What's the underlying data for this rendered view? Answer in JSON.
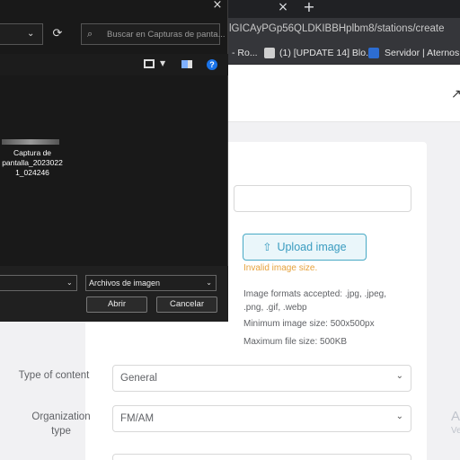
{
  "browser": {
    "tab_close": "×",
    "new_tab": "+",
    "url": "lGICAyPGp56QLDKIBBHplbm8/stations/create",
    "bookmarks": [
      {
        "label": "- Ro..."
      },
      {
        "label": "(1) [UPDATE 14] Blo..."
      },
      {
        "label": "Servidor | Aternos |..."
      }
    ]
  },
  "form": {
    "upload_button": "Upload image",
    "upload_error": "Invalid image size.",
    "hints": [
      "Image formats accepted: .jpg, .jpeg,",
      ".png, .gif, .webp",
      "Minimum image size: 500x500px",
      "Maximum file size: 500KB"
    ],
    "type_of_content": {
      "label": "Type of content",
      "value": "General"
    },
    "organization_type": {
      "label_line1": "Organization",
      "label_line2": "type",
      "value": "FM/AM"
    },
    "side_letter": "A",
    "side_text": "Ve"
  },
  "file_dialog": {
    "close": "×",
    "search_placeholder": "Buscar en Capturas de panta...",
    "file_name_lines": [
      "Captura de",
      "pantalla_2023022",
      "1_024246"
    ],
    "file_type": "Archivos de imagen",
    "open_button": "Abrir",
    "cancel_button": "Cancelar"
  },
  "colors": {
    "accent": "#3a9cc0",
    "error": "#e6a23c",
    "dialog_bg": "#191919",
    "browser_bg": "#35363a"
  }
}
